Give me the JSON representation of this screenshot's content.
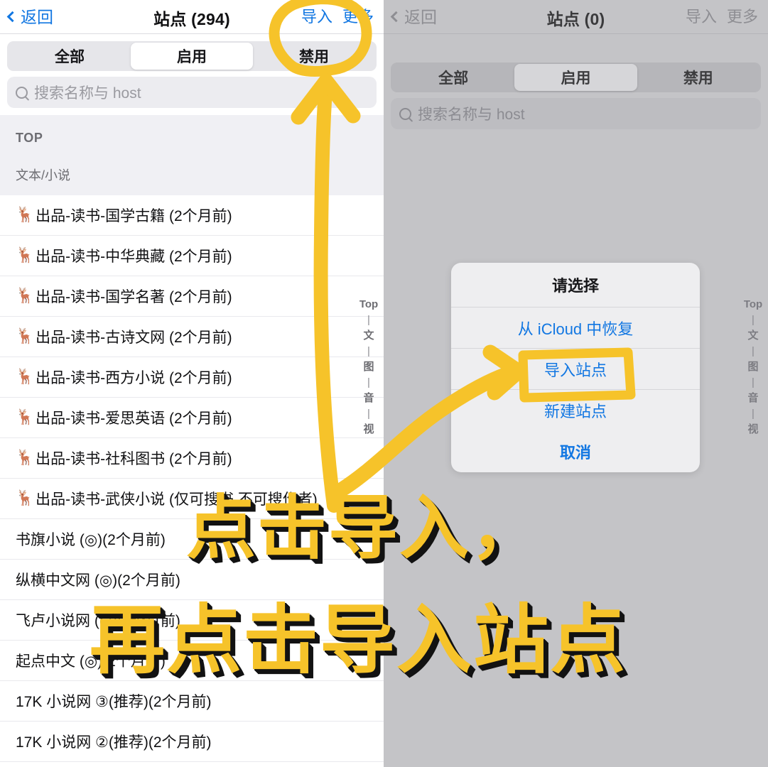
{
  "left_panel": {
    "navbar": {
      "back_label": "返回",
      "title": "站点 (294)",
      "import_label": "导入",
      "more_label": "更多"
    },
    "segments": [
      {
        "label": "全部",
        "active": false
      },
      {
        "label": "启用",
        "active": true
      },
      {
        "label": "禁用",
        "active": false
      }
    ],
    "search": {
      "placeholder": "搜索名称与 host"
    },
    "section": {
      "top_label": "TOP",
      "category_label": "文本/小说"
    },
    "rows": [
      {
        "icon": "🦌",
        "label": "出品-读书-国学古籍 (2个月前)"
      },
      {
        "icon": "🦌",
        "label": "出品-读书-中华典藏 (2个月前)"
      },
      {
        "icon": "🦌",
        "label": "出品-读书-国学名著 (2个月前)"
      },
      {
        "icon": "🦌",
        "label": "出品-读书-古诗文网 (2个月前)"
      },
      {
        "icon": "🦌",
        "label": "出品-读书-西方小说 (2个月前)"
      },
      {
        "icon": "🦌",
        "label": "出品-读书-爱思英语 (2个月前)"
      },
      {
        "icon": "🦌",
        "label": "出品-读书-社科图书 (2个月前)"
      },
      {
        "icon": "🦌",
        "label": "出品-读书-武侠小说 (仅可搜书,不可搜作者)"
      },
      {
        "icon": "",
        "label": "书旗小说 (◎)(2个月前)"
      },
      {
        "icon": "",
        "label": "纵横中文网 (◎)(2个月前)"
      },
      {
        "icon": "",
        "label": "飞卢小说网 (◎)(2个月前)"
      },
      {
        "icon": "",
        "label": "起点中文 (◎)(2个月前)"
      },
      {
        "icon": "",
        "label": "17K 小说网 ③(推荐)(2个月前)"
      },
      {
        "icon": "",
        "label": "17K 小说网 ②(推荐)(2个月前)"
      }
    ],
    "index_strip": [
      "Top",
      "|",
      "文",
      "|",
      "图",
      "|",
      "音",
      "|",
      "视"
    ]
  },
  "right_panel": {
    "navbar": {
      "back_label": "返回",
      "title": "站点 (0)",
      "import_label": "导入",
      "more_label": "更多"
    },
    "segments": [
      {
        "label": "全部",
        "active": false
      },
      {
        "label": "启用",
        "active": true
      },
      {
        "label": "禁用",
        "active": false
      }
    ],
    "search": {
      "placeholder": "搜索名称与 host"
    },
    "index_strip": [
      "Top",
      "|",
      "文",
      "|",
      "图",
      "|",
      "音",
      "|",
      "视"
    ]
  },
  "dialog": {
    "title": "请选择",
    "items": [
      "从 iCloud 中恢复",
      "导入站点",
      "新建站点"
    ],
    "cancel_label": "取消"
  },
  "annotation": {
    "caption_line1": "点击导入，",
    "caption_line2": "再点击导入站点",
    "marker_color": "#f6c32a",
    "shadow_color": "#121212",
    "shapes": [
      {
        "name": "circle-around-import",
        "type": "ellipse-outline"
      },
      {
        "name": "arrow-up-to-import",
        "type": "arrow"
      },
      {
        "name": "arrow-to-import-site",
        "type": "arrow"
      },
      {
        "name": "box-around-import-site",
        "type": "rect-outline"
      }
    ]
  }
}
